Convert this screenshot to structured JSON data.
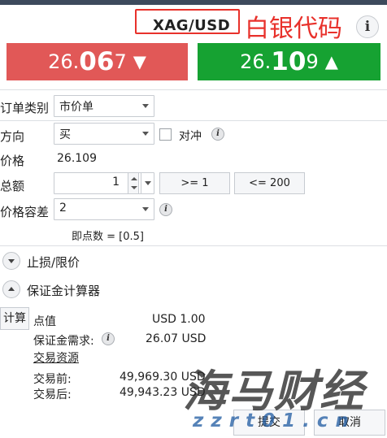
{
  "header": {
    "symbol": "XAG/USD",
    "annotation": "白银代码",
    "info_label": "i"
  },
  "prices": {
    "sell": {
      "small": "26.",
      "big": "06",
      "last": "7",
      "arrow": "▼"
    },
    "buy": {
      "small": "26.",
      "big": "10",
      "last": "9",
      "arrow": "▲"
    }
  },
  "form": {
    "order_type_label": "订单类别",
    "order_type_value": "市价单",
    "direction_label": "方向",
    "direction_value": "买",
    "hedge_label": "对冲",
    "price_label": "价格",
    "price_value": "26.109",
    "amount_label": "总额",
    "amount_value": "1",
    "min_label": ">= 1",
    "max_label": "<= 200",
    "slippage_label": "价格容差",
    "slippage_value": "2",
    "pips_note": "即点数 = [0.5]",
    "tip_icon": "i"
  },
  "sections": {
    "stop_limit": "止损/限价",
    "margin_calc": "保证金计算器"
  },
  "calculator": {
    "calc_button": "计算",
    "pip_value_label": "点值",
    "pip_value": "USD 1.00",
    "margin_req_label": "保证金需求:",
    "margin_req_value": "26.07 USD",
    "resources_link": "交易资源",
    "before_label": "交易前:",
    "before_value": "49,969.30 USD",
    "after_label": "交易后:",
    "after_value": "49,943.23 USD"
  },
  "actions": {
    "submit": "提交",
    "cancel": "取消"
  },
  "watermark": {
    "text": "海马财经",
    "url": "zzrt01.cn"
  },
  "colors": {
    "sell": "#e15857",
    "buy": "#16a232",
    "annotation": "#e8312b"
  }
}
